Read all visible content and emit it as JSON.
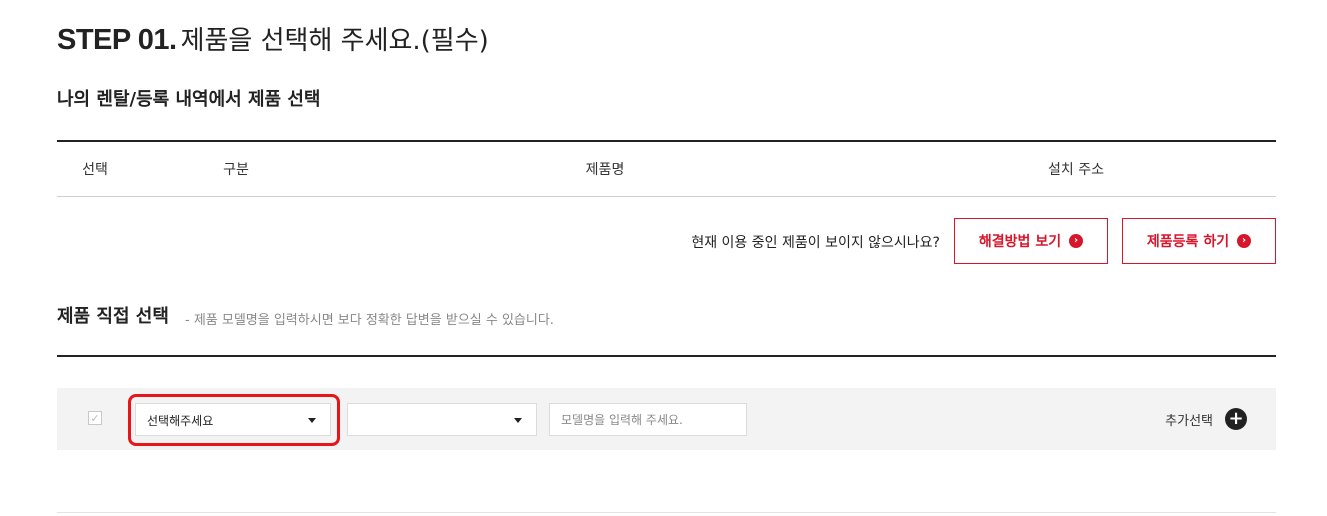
{
  "step": {
    "number": "STEP 01.",
    "text": "제품을 선택해 주세요.(필수)"
  },
  "rental_section": {
    "title": "나의 렌탈/등록 내역에서 제품 선택",
    "columns": [
      "선택",
      "구분",
      "제품명",
      "설치 주소"
    ],
    "notice": "현재 이용 중인 제품이 보이지 않으시나요?",
    "solution_button": "해결방법 보기",
    "register_button": "제품등록 하기"
  },
  "direct_section": {
    "title": "제품 직접 선택",
    "subtitle": "- 제품 모델명을 입력하시면 보다 정확한 답변을 받으실 수 있습니다.",
    "select1_value": "선택해주세요",
    "select2_value": "",
    "model_placeholder": "모델명을 입력해 주세요.",
    "add_select_label": "추가선택"
  },
  "colors": {
    "accent_red": "#d7152b",
    "highlight_red": "#e8141a",
    "row_background": "#f3f3f3"
  },
  "icons": {
    "button_arrow": "chevron-right-circle-icon",
    "add": "plus-circle-icon",
    "checkbox": "check-icon",
    "dropdown": "caret-down-icon"
  }
}
